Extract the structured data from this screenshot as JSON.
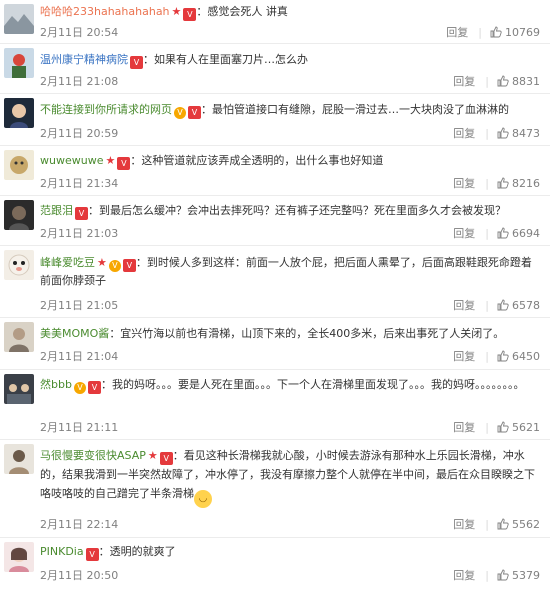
{
  "ui": {
    "reply_label": "回复",
    "badge_glyph": "V",
    "vip_glyph": "V",
    "star_glyph": "★",
    "emoji_glyph": "◡"
  },
  "comments": [
    {
      "user": "哈哈哈233hahahahahah",
      "text": "：感觉会死人 讲真",
      "date": "2月11日 20:54",
      "likes": "10769"
    },
    {
      "user": "温州康宁精神病院",
      "text": "：如果有人在里面塞刀片…怎么办",
      "date": "2月11日 21:08",
      "likes": "8831"
    },
    {
      "user": "不能连接到你所请求的网页",
      "text": "：最怕管道接口有缝隙，屁股一滑过去…一大块肉没了血淋淋的",
      "date": "2月11日 20:59",
      "likes": "8473"
    },
    {
      "user": "wuwewuwe",
      "text": "：这种管道就应该弄成全透明的，出什么事也好知道",
      "date": "2月11日 21:34",
      "likes": "8216"
    },
    {
      "user": "范跟泪",
      "text": "：到最后怎么缓冲？会冲出去摔死吗？还有裤子还完整吗？死在里面多久才会被发现？",
      "date": "2月11日 21:03",
      "likes": "6694"
    },
    {
      "user": "峰峰爱吃豆",
      "text": "：到时候人多到这样：前面一人放个屁，把后面人熏晕了，后面高跟鞋跟死命蹬着前面你脖颈子",
      "date": "2月11日 21:05",
      "likes": "6578"
    },
    {
      "user": "美美MOMO酱",
      "text": "：宜兴竹海以前也有滑梯，山顶下来的，全长400多米，后来出事死了人关闭了。",
      "date": "2月11日 21:04",
      "likes": "6450"
    },
    {
      "user": "然bbb",
      "text": "：我的妈呀。。。要是人死在里面。。。下一个人在滑梯里面发现了。。。我的妈呀。。。。。。。。",
      "date": "2月11日 21:11",
      "likes": "5621"
    },
    {
      "user": "马很慢要变很快ASAP",
      "text": "：看见这种长滑梯我就心酸，小时候去游泳有那种水上乐园长滑梯，冲水的，结果我滑到一半突然故障了，冲水停了，我没有摩擦力整个人就停在半中间，最后在众目睽睽之下咯吱咯吱的自己蹭完了半条滑梯",
      "date": "2月11日 22:14",
      "likes": "5562"
    },
    {
      "user": "PINKDia",
      "text": "：透明的就爽了",
      "date": "2月11日 20:50",
      "likes": "5379"
    }
  ]
}
